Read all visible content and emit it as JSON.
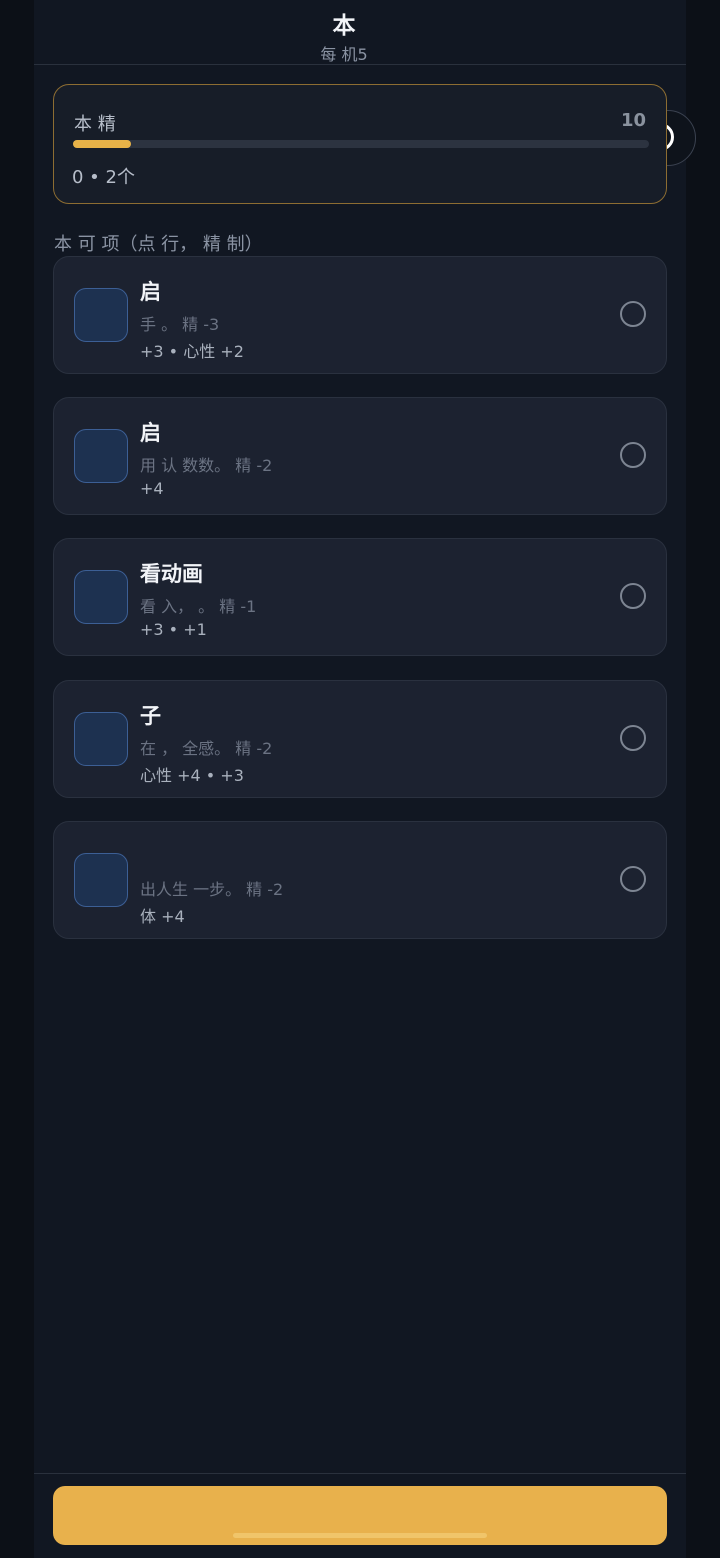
{
  "header": {
    "title": "本  ",
    "subtitle": "每  机5"
  },
  "capsule": {
    "more_icon": "more-dots-icon",
    "more_glyph": "•●•",
    "close_icon": "target-close-icon"
  },
  "energy": {
    "label": "本 精",
    "value": "10",
    "progress_fraction": 0.1,
    "status": "0  • 2个"
  },
  "section": {
    "label": "本 可  项（点  行， 精  制）"
  },
  "options": [
    {
      "icon_glyph": "",
      "title": "  启",
      "desc": "    手  。 精 -3",
      "effect": "  +3 • 心性 +2"
    },
    {
      "icon_glyph": "",
      "title": "启  ",
      "desc": "  用   认 数数。 精 -2",
      "effect": "  +4"
    },
    {
      "icon_glyph": "",
      "title": "看动画",
      "desc": "看 入，   。 精 -1",
      "effect": "  +3 •   +1"
    },
    {
      "icon_glyph": "",
      "title": " 子 ",
      "desc": "    在 ，  全感。 精 -2",
      "effect": "心性 +4 •   +3"
    },
    {
      "icon_glyph": "",
      "title": "  ",
      "desc": "    出人生 一步。 精 -2",
      "effect": "体 +4"
    }
  ],
  "footer": {
    "confirm_label": " "
  },
  "colors": {
    "accent": "#e8b14c",
    "background": "#111722",
    "card": "#1c2230"
  }
}
